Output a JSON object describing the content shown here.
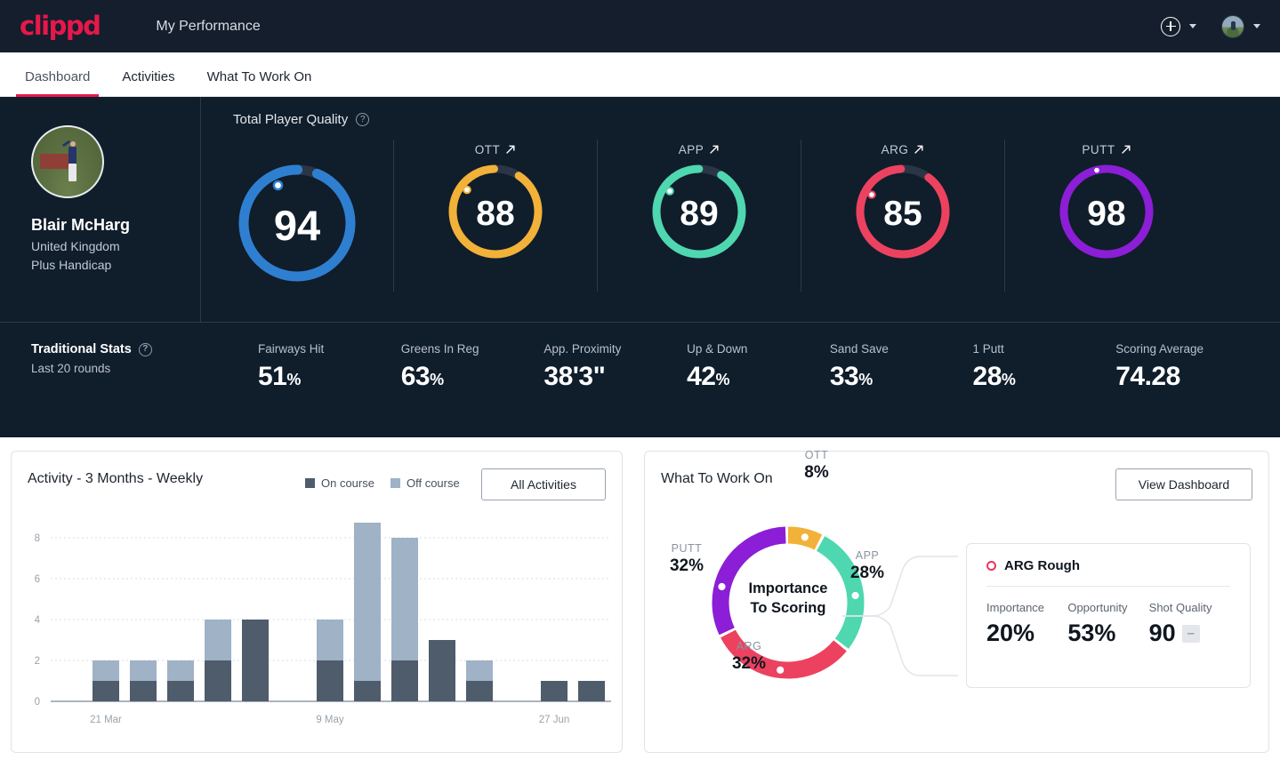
{
  "header": {
    "logo": "clippd",
    "app_title": "My Performance",
    "add_icon": "plus-circle-icon",
    "chevron_icon": "chevron-down-icon",
    "avatar_icon": "user-avatar"
  },
  "tabs": [
    {
      "label": "Dashboard",
      "active": true
    },
    {
      "label": "Activities",
      "active": false
    },
    {
      "label": "What To Work On",
      "active": false
    }
  ],
  "player": {
    "name": "Blair McHarg",
    "country": "United Kingdom",
    "handicap": "Plus Handicap"
  },
  "quality": {
    "section_label": "Total Player Quality",
    "help_icon": "question-mark-icon",
    "main": {
      "label": "",
      "value": "94",
      "color": "#2f7fd1"
    },
    "categories": [
      {
        "label": "OTT",
        "value": "88",
        "color": "#f2b138",
        "trend": "up-right-arrow-icon"
      },
      {
        "label": "APP",
        "value": "89",
        "color": "#4fd7b0",
        "trend": "up-right-arrow-icon"
      },
      {
        "label": "ARG",
        "value": "85",
        "color": "#ec4260",
        "trend": "up-right-arrow-icon"
      },
      {
        "label": "PUTT",
        "value": "98",
        "color": "#8b1ed6",
        "trend": "up-right-arrow-icon"
      }
    ]
  },
  "traditional_stats": {
    "title": "Traditional Stats",
    "help_icon": "question-mark-icon",
    "subtitle": "Last 20 rounds",
    "items": [
      {
        "label": "Fairways Hit",
        "value": "51",
        "unit": "%"
      },
      {
        "label": "Greens In Reg",
        "value": "63",
        "unit": "%"
      },
      {
        "label": "App. Proximity",
        "value": "38'3\"",
        "unit": ""
      },
      {
        "label": "Up & Down",
        "value": "42",
        "unit": "%"
      },
      {
        "label": "Sand Save",
        "value": "33",
        "unit": "%"
      },
      {
        "label": "1 Putt",
        "value": "28",
        "unit": "%"
      },
      {
        "label": "Scoring Average",
        "value": "74.28",
        "unit": ""
      }
    ]
  },
  "activity_card": {
    "title": "Activity - 3 Months - Weekly",
    "button": "All Activities",
    "legend": [
      {
        "label": "On course",
        "color": "#4e5c6b"
      },
      {
        "label": "Off course",
        "color": "#9fb2c6"
      }
    ]
  },
  "wtwo_card": {
    "title": "What To Work On",
    "button": "View Dashboard",
    "center_line1": "Importance",
    "center_line2": "To Scoring",
    "detail": {
      "title": "ARG Rough",
      "marker_icon": "circle-outline-icon",
      "marker_color": "#e8345e",
      "metrics": [
        {
          "label": "Importance",
          "value": "20%",
          "badge": ""
        },
        {
          "label": "Opportunity",
          "value": "53%",
          "badge": ""
        },
        {
          "label": "Shot Quality",
          "value": "90",
          "badge": "–"
        }
      ]
    }
  },
  "chart_data": [
    {
      "type": "bar",
      "title": "Activity - 3 Months - Weekly",
      "stacked": true,
      "xlabel": "",
      "ylabel": "",
      "ylim": [
        0,
        9.6
      ],
      "yticks": [
        0,
        2,
        4,
        6,
        8
      ],
      "grid": true,
      "legend_position": "top-right",
      "categories": [
        "w1",
        "w2",
        "w3",
        "w4",
        "w5",
        "w6",
        "w7",
        "w8",
        "w9",
        "w10",
        "w11",
        "w12",
        "w13",
        "w14",
        "w15"
      ],
      "tick_labels": [
        {
          "index": 1,
          "label": "21 Mar"
        },
        {
          "index": 7,
          "label": "9 May"
        },
        {
          "index": 13,
          "label": "27 Jun"
        }
      ],
      "series": [
        {
          "name": "On course",
          "color": "#4e5c6b",
          "values": [
            0,
            1,
            1,
            1,
            2,
            4,
            0,
            2,
            1,
            2,
            3,
            1,
            0,
            1,
            1
          ]
        },
        {
          "name": "Off course",
          "color": "#9fb2c6",
          "values": [
            0,
            1,
            1,
            1,
            2,
            0,
            0,
            2,
            8,
            6,
            0,
            1,
            0,
            0,
            0
          ]
        }
      ]
    },
    {
      "type": "pie",
      "subtype": "donut",
      "title": "Importance To Scoring",
      "labels": [
        "OTT",
        "APP",
        "ARG",
        "PUTT"
      ],
      "values": [
        8,
        28,
        32,
        32
      ],
      "value_labels": [
        "8%",
        "28%",
        "32%",
        "32%"
      ],
      "colors": [
        "#f2b138",
        "#4fd7b0",
        "#ec4260",
        "#8b1ed6"
      ],
      "legend_position": "around"
    }
  ]
}
